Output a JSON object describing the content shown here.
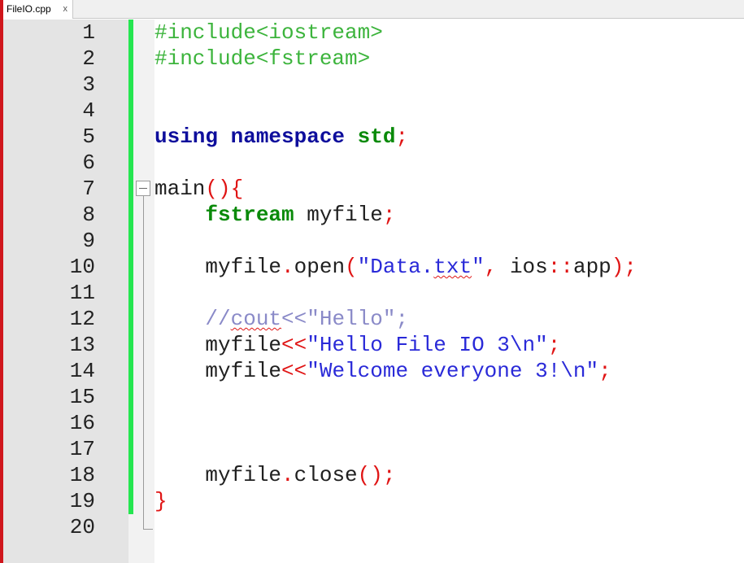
{
  "tab": {
    "title": "FileIO.cpp",
    "close": "x"
  },
  "lines": [
    [
      {
        "t": "#include<iostream>",
        "c": "pre"
      }
    ],
    [
      {
        "t": "#include<fstream>",
        "c": "pre"
      }
    ],
    [],
    [],
    [
      {
        "t": "using namespace ",
        "c": "kw"
      },
      {
        "t": "std",
        "c": "type"
      },
      {
        "t": ";",
        "c": "op"
      }
    ],
    [],
    [
      {
        "t": "main",
        "c": "plain"
      },
      {
        "t": "(){",
        "c": "op"
      }
    ],
    [
      {
        "t": "    ",
        "c": "plain"
      },
      {
        "t": "fstream",
        "c": "type"
      },
      {
        "t": " myfile",
        "c": "plain"
      },
      {
        "t": ";",
        "c": "op"
      }
    ],
    [],
    [
      {
        "t": "    myfile",
        "c": "plain"
      },
      {
        "t": ".",
        "c": "op"
      },
      {
        "t": "open",
        "c": "plain"
      },
      {
        "t": "(",
        "c": "op"
      },
      {
        "t": "\"Data.",
        "c": "str"
      },
      {
        "t": "txt",
        "c": "str-squig"
      },
      {
        "t": "\"",
        "c": "str"
      },
      {
        "t": ", ",
        "c": "op"
      },
      {
        "t": "ios",
        "c": "plain"
      },
      {
        "t": "::",
        "c": "op"
      },
      {
        "t": "app",
        "c": "plain"
      },
      {
        "t": ");",
        "c": "op"
      }
    ],
    [],
    [
      {
        "t": "    //",
        "c": "cmt"
      },
      {
        "t": "cout",
        "c": "cmt-squig"
      },
      {
        "t": "<<\"Hello\";",
        "c": "cmt"
      }
    ],
    [
      {
        "t": "    myfile",
        "c": "plain"
      },
      {
        "t": "<<",
        "c": "op"
      },
      {
        "t": "\"Hello File IO 3\\n\"",
        "c": "str"
      },
      {
        "t": ";",
        "c": "op"
      }
    ],
    [
      {
        "t": "    myfile",
        "c": "plain"
      },
      {
        "t": "<<",
        "c": "op"
      },
      {
        "t": "\"Welcome everyone 3!\\n\"",
        "c": "str"
      },
      {
        "t": ";",
        "c": "op"
      }
    ],
    [],
    [],
    [],
    [
      {
        "t": "    myfile",
        "c": "plain"
      },
      {
        "t": ".",
        "c": "op"
      },
      {
        "t": "close",
        "c": "plain"
      },
      {
        "t": "();",
        "c": "op"
      }
    ],
    [
      {
        "t": "}",
        "c": "op"
      }
    ],
    []
  ],
  "colors": {
    "preprocessor": "#3cb43c",
    "keyword": "#0e0e9c",
    "type": "#0a8a0a",
    "operator": "#e01515",
    "string": "#2a2ad8",
    "comment": "#8a8ac8",
    "change_bar": "#25e650"
  },
  "icons": {
    "fold": "fold-minus-icon",
    "tab_close": "close-icon"
  }
}
